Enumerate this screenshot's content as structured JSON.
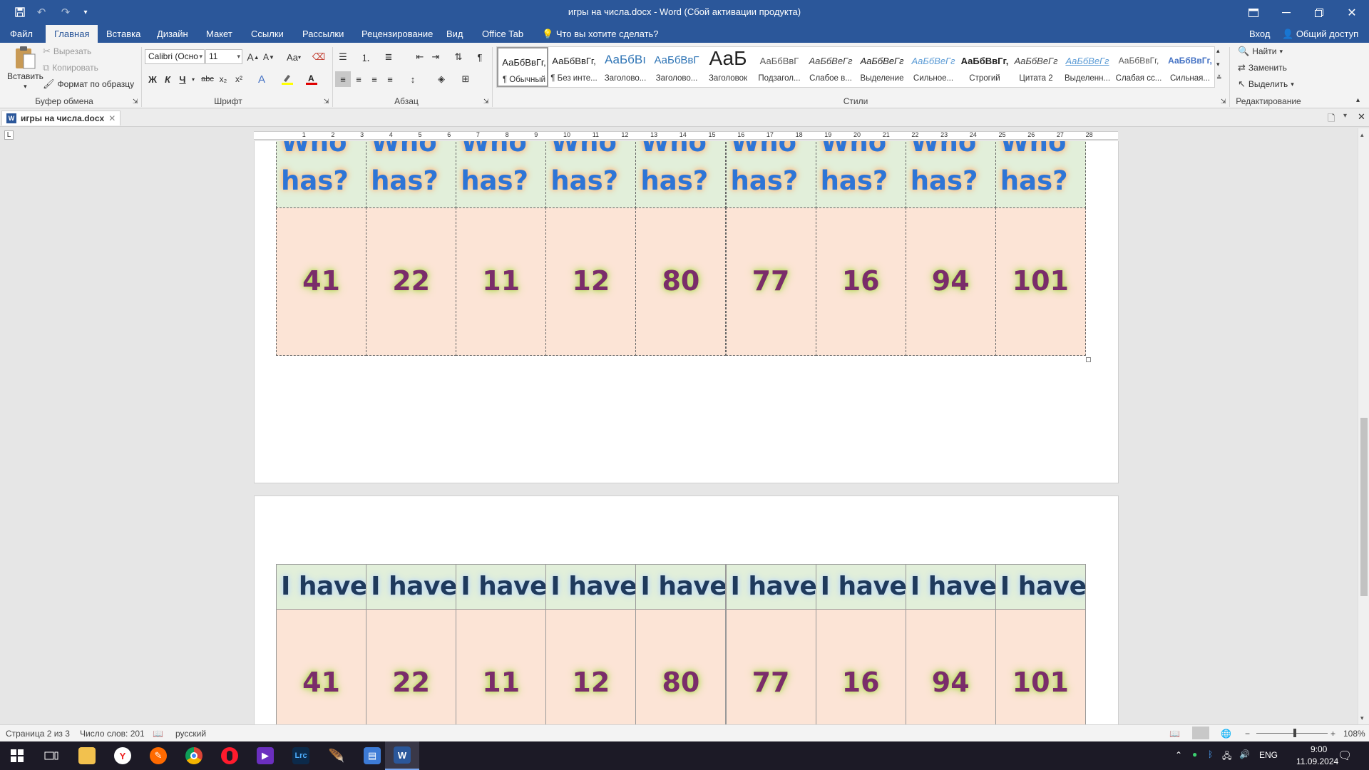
{
  "app": {
    "window_title": "игры на числа.docx - Word (Сбой активации продукта)"
  },
  "quick_access": {
    "save_icon": "save-icon",
    "undo_icon": "undo-icon",
    "redo_icon": "redo-icon"
  },
  "window_controls": {
    "ribbon_options": "ribbon-display-icon",
    "minimize": "minimize-icon",
    "restore": "restore-icon",
    "close": "close-icon"
  },
  "tabs": [
    {
      "label": "Файл"
    },
    {
      "label": "Главная"
    },
    {
      "label": "Вставка"
    },
    {
      "label": "Дизайн"
    },
    {
      "label": "Макет"
    },
    {
      "label": "Ссылки"
    },
    {
      "label": "Рассылки"
    },
    {
      "label": "Рецензирование"
    },
    {
      "label": "Вид"
    },
    {
      "label": "Office Tab"
    },
    {
      "label": "Что вы хотите сделать?"
    }
  ],
  "account": {
    "signin": "Вход",
    "share": "Общий доступ"
  },
  "clipboard": {
    "paste": "Вставить",
    "cut": "Вырезать",
    "copy": "Копировать",
    "format_painter": "Формат по образцу",
    "group_label": "Буфер обмена"
  },
  "font": {
    "family": "Calibri (Осно",
    "size": "11",
    "bold": "Ж",
    "italic": "К",
    "underline": "Ч",
    "strike": "abc",
    "subscript": "x₂",
    "superscript": "x²",
    "change_case": "Aa",
    "grow": "A",
    "shrink": "A",
    "group_label": "Шрифт",
    "highlight_color": "#ffff00",
    "font_color": "#e00000"
  },
  "paragraph": {
    "group_label": "Абзац",
    "show_marks": "¶"
  },
  "styles": {
    "group_label": "Стили",
    "items": [
      {
        "preview": "АаБбВвГг,",
        "name": "¶ Обычный",
        "color": "#000000"
      },
      {
        "preview": "АаБбВвГг,",
        "name": "¶ Без инте...",
        "color": "#000000"
      },
      {
        "preview": "АаБбВı",
        "name": "Заголово...",
        "color": "#2e74b5"
      },
      {
        "preview": "АаБбВвГ",
        "name": "Заголово...",
        "color": "#2e74b5"
      },
      {
        "preview": "АаБ",
        "name": "Заголовок",
        "color": "#000000"
      },
      {
        "preview": "АаБбВвГ",
        "name": "Подзагол...",
        "color": "#595959"
      },
      {
        "preview": "АаБбВеГг",
        "name": "Слабое в...",
        "color": "#404040"
      },
      {
        "preview": "АаБбВеГг",
        "name": "Выделение",
        "color": "#000000"
      },
      {
        "preview": "АаБбВеГг",
        "name": "Сильное...",
        "color": "#5b9bd5"
      },
      {
        "preview": "АаБбВвГг,",
        "name": "Строгий",
        "color": "#000000"
      },
      {
        "preview": "АаБбВеГг",
        "name": "Цитата 2",
        "color": "#404040"
      },
      {
        "preview": "АаБбВеГг",
        "name": "Выделенн...",
        "color": "#5b9bd5"
      },
      {
        "preview": "АаБбВвГг,",
        "name": "Слабая сс...",
        "color": "#595959"
      },
      {
        "preview": "АаБбВвГг,",
        "name": "Сильная...",
        "color": "#4472c4"
      }
    ]
  },
  "editing": {
    "find": "Найти",
    "replace": "Заменить",
    "select": "Выделить",
    "group_label": "Редактирование"
  },
  "doc_tab": {
    "label": "игры на числа.docx"
  },
  "ruler": {
    "marks": [
      "1",
      "2",
      "3",
      "4",
      "5",
      "6",
      "7",
      "8",
      "9",
      "10",
      "11",
      "12",
      "13",
      "14",
      "15",
      "16",
      "17",
      "18",
      "19",
      "20",
      "21",
      "22",
      "23",
      "24",
      "25",
      "26",
      "27",
      "28"
    ]
  },
  "document": {
    "top_cards": {
      "line1": "Who",
      "line2": "has?",
      "numbers": [
        "41",
        "22",
        "11",
        "12",
        "80",
        "77",
        "16",
        "94",
        "101"
      ]
    },
    "bottom_cards": {
      "label": "I have",
      "numbers": [
        "41",
        "22",
        "11",
        "12",
        "80",
        "77",
        "16",
        "94",
        "101"
      ]
    }
  },
  "status": {
    "page": "Страница 2 из 3",
    "words": "Число слов: 201",
    "language": "русский",
    "zoom": "108%",
    "zoom_fraction": 0.54
  },
  "taskbar": {
    "lang": "ENG",
    "time": "9:00",
    "date": "11.09.2024",
    "apps": [
      {
        "name": "start-icon"
      },
      {
        "name": "task-view-icon"
      },
      {
        "name": "file-explorer-icon"
      },
      {
        "name": "yandex-browser-icon",
        "text": "Y",
        "color": "#ffffff"
      },
      {
        "name": "pencil-app-icon",
        "color": "#ff6a00"
      },
      {
        "name": "chrome-icon"
      },
      {
        "name": "opera-icon"
      },
      {
        "name": "video-app-icon",
        "color": "#6b2fbf"
      },
      {
        "name": "lightroom-icon",
        "text": "Lrc",
        "color": "#0c2a4a"
      },
      {
        "name": "feather-icon"
      },
      {
        "name": "folder-app-icon"
      },
      {
        "name": "word-icon",
        "text": "W",
        "color": "#2b579a"
      }
    ]
  }
}
